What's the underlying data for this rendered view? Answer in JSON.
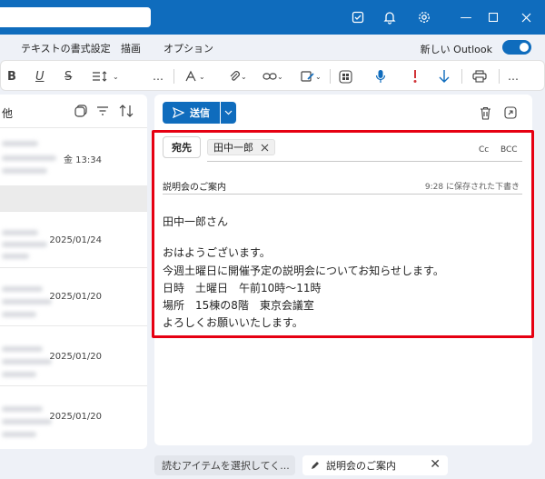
{
  "menu": {
    "items": [
      "テキストの書式設定",
      "描画",
      "オプション"
    ],
    "new_outlook_label": "新しい Outlook"
  },
  "ribbon": {
    "bold": "B",
    "more": "…"
  },
  "list": {
    "title": "他",
    "rows": [
      {
        "date": "金 13:34"
      },
      {
        "date": "2025/01/24"
      },
      {
        "date": "2025/01/20"
      },
      {
        "date": "2025/01/20"
      },
      {
        "date": "2025/01/20"
      }
    ]
  },
  "compose": {
    "send_label": "送信",
    "to_label": "宛先",
    "recipient": "田中一郎",
    "cc": "Cc",
    "bcc": "BCC",
    "subject": "説明会のご案内",
    "saved_status": "9:28 に保存された下書き",
    "body": [
      "田中一郎さん",
      "",
      "おはようございます。",
      "今週土曜日に開催予定の説明会についてお知らせします。",
      "日時　土曜日　午前10時～11時",
      "場所　15棟の8階　東京会議室",
      "よろしくお願いいたします。"
    ]
  },
  "bottom_tabs": {
    "tab1": "読むアイテムを選択してく...",
    "tab2": "説明会のご案内"
  },
  "colors": {
    "accent": "#0f6cbd",
    "highlight": "#e60012"
  }
}
